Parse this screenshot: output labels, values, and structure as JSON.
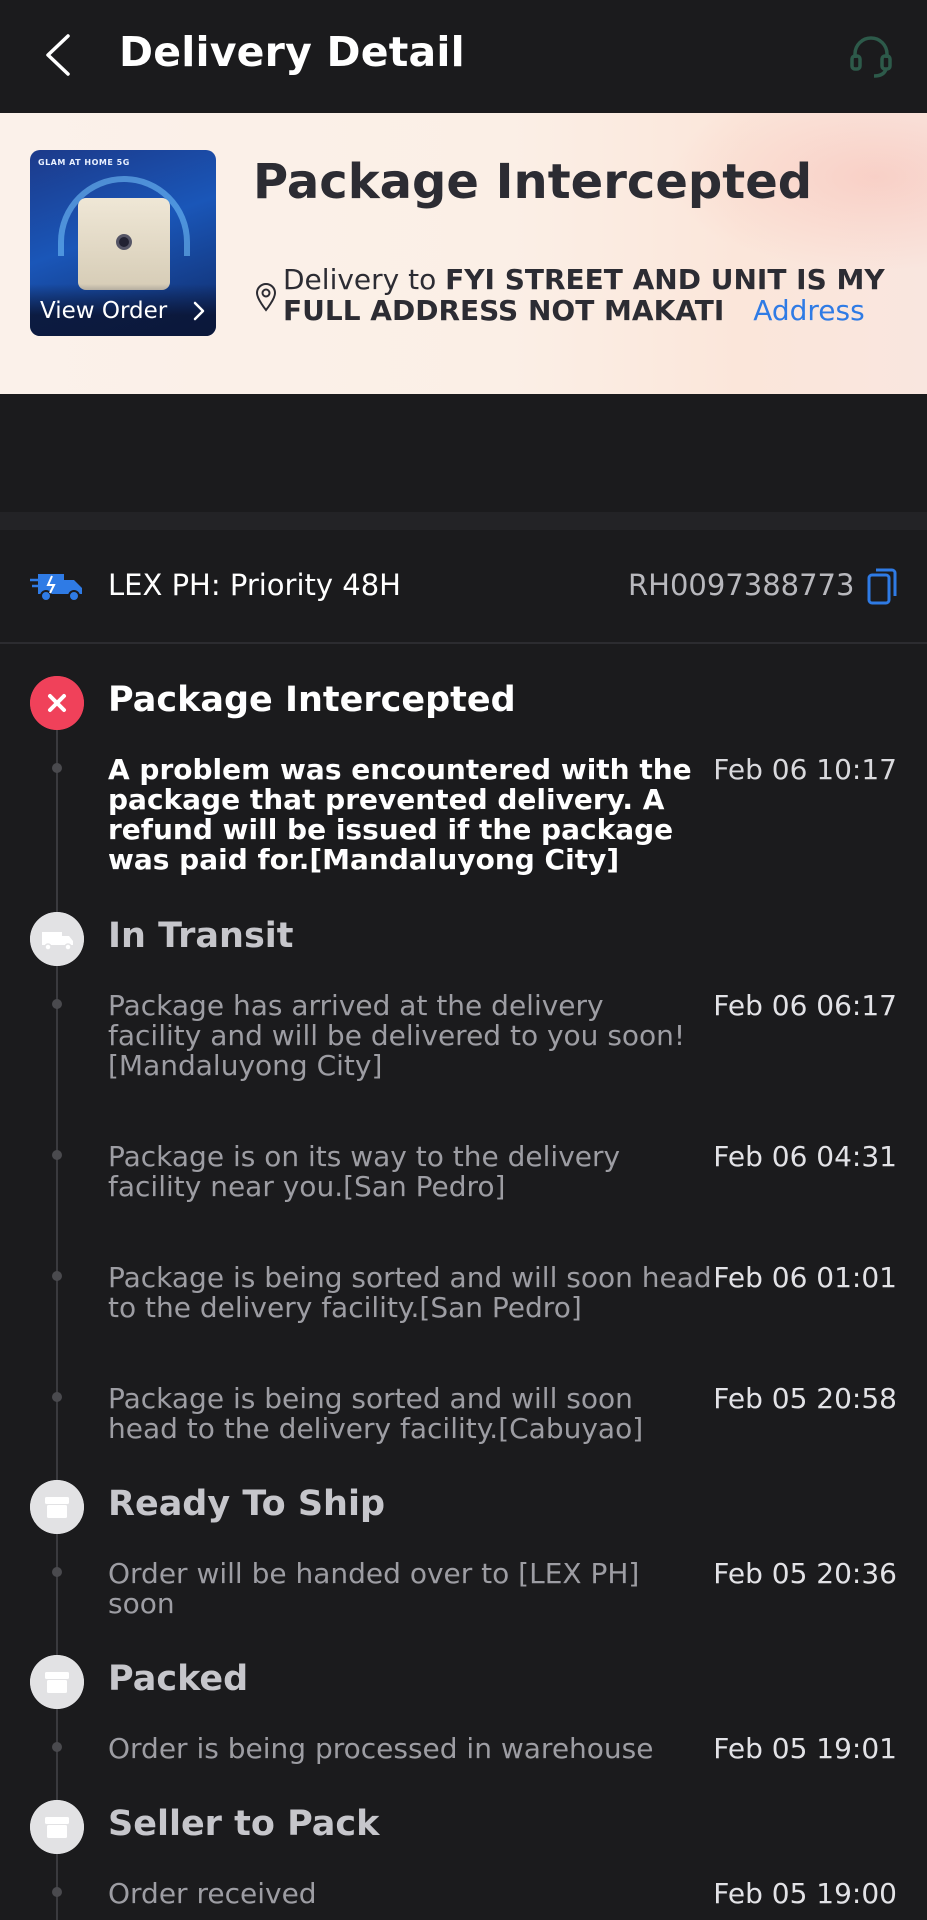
{
  "header": {
    "title": "Delivery Detail",
    "back_icon": "chevron-left-icon",
    "support_icon": "headset-icon"
  },
  "banner": {
    "status": "Package Intercepted",
    "view_order_label": "View Order",
    "thumb_logo": "GLAM AT HOME 5G",
    "delivery_prefix": "Delivery to",
    "delivery_address": "FYI STREET AND UNIT IS MY FULL ADDRESS NOT MAKATI",
    "address_link": "Address"
  },
  "carrier": {
    "name": "LEX PH: Priority 48H",
    "tracking_number": "RH0097388773"
  },
  "colors": {
    "accent_blue": "#2f7be5",
    "status_red": "#f0415a",
    "background": "#1b1b1d"
  },
  "timeline": [
    {
      "title": "Package Intercepted",
      "icon": "close-x-icon",
      "events": [
        {
          "text": "A problem was encountered with the package that prevented delivery. A refund will be issued if the package was paid for.[Mandaluyong City]",
          "time": "Feb 06 10:17"
        }
      ]
    },
    {
      "title": "In Transit",
      "icon": "truck-icon",
      "events": [
        {
          "text": "Package has arrived at the delivery facility and will be delivered to you soon![Mandaluyong City]",
          "time": "Feb 06 06:17"
        },
        {
          "text": "Package is on its way to the delivery facility near you.[San Pedro]",
          "time": "Feb 06 04:31"
        },
        {
          "text": "Package is being sorted and will soon head to the delivery facility.[San Pedro]",
          "time": "Feb 06 01:01"
        },
        {
          "text": "Package is being sorted and will soon head to the delivery facility.[Cabuyao]",
          "time": "Feb 05 20:58"
        }
      ]
    },
    {
      "title": "Ready To Ship",
      "icon": "box-icon",
      "events": [
        {
          "text": "Order will be handed over to [LEX PH] soon",
          "time": "Feb 05 20:36"
        }
      ]
    },
    {
      "title": "Packed",
      "icon": "box-icon",
      "events": [
        {
          "text": "Order is being processed in warehouse",
          "time": "Feb 05 19:01"
        }
      ]
    },
    {
      "title": "Seller to Pack",
      "icon": "box-icon",
      "events": [
        {
          "text": "Order received",
          "time": "Feb 05 19:00"
        }
      ]
    }
  ]
}
